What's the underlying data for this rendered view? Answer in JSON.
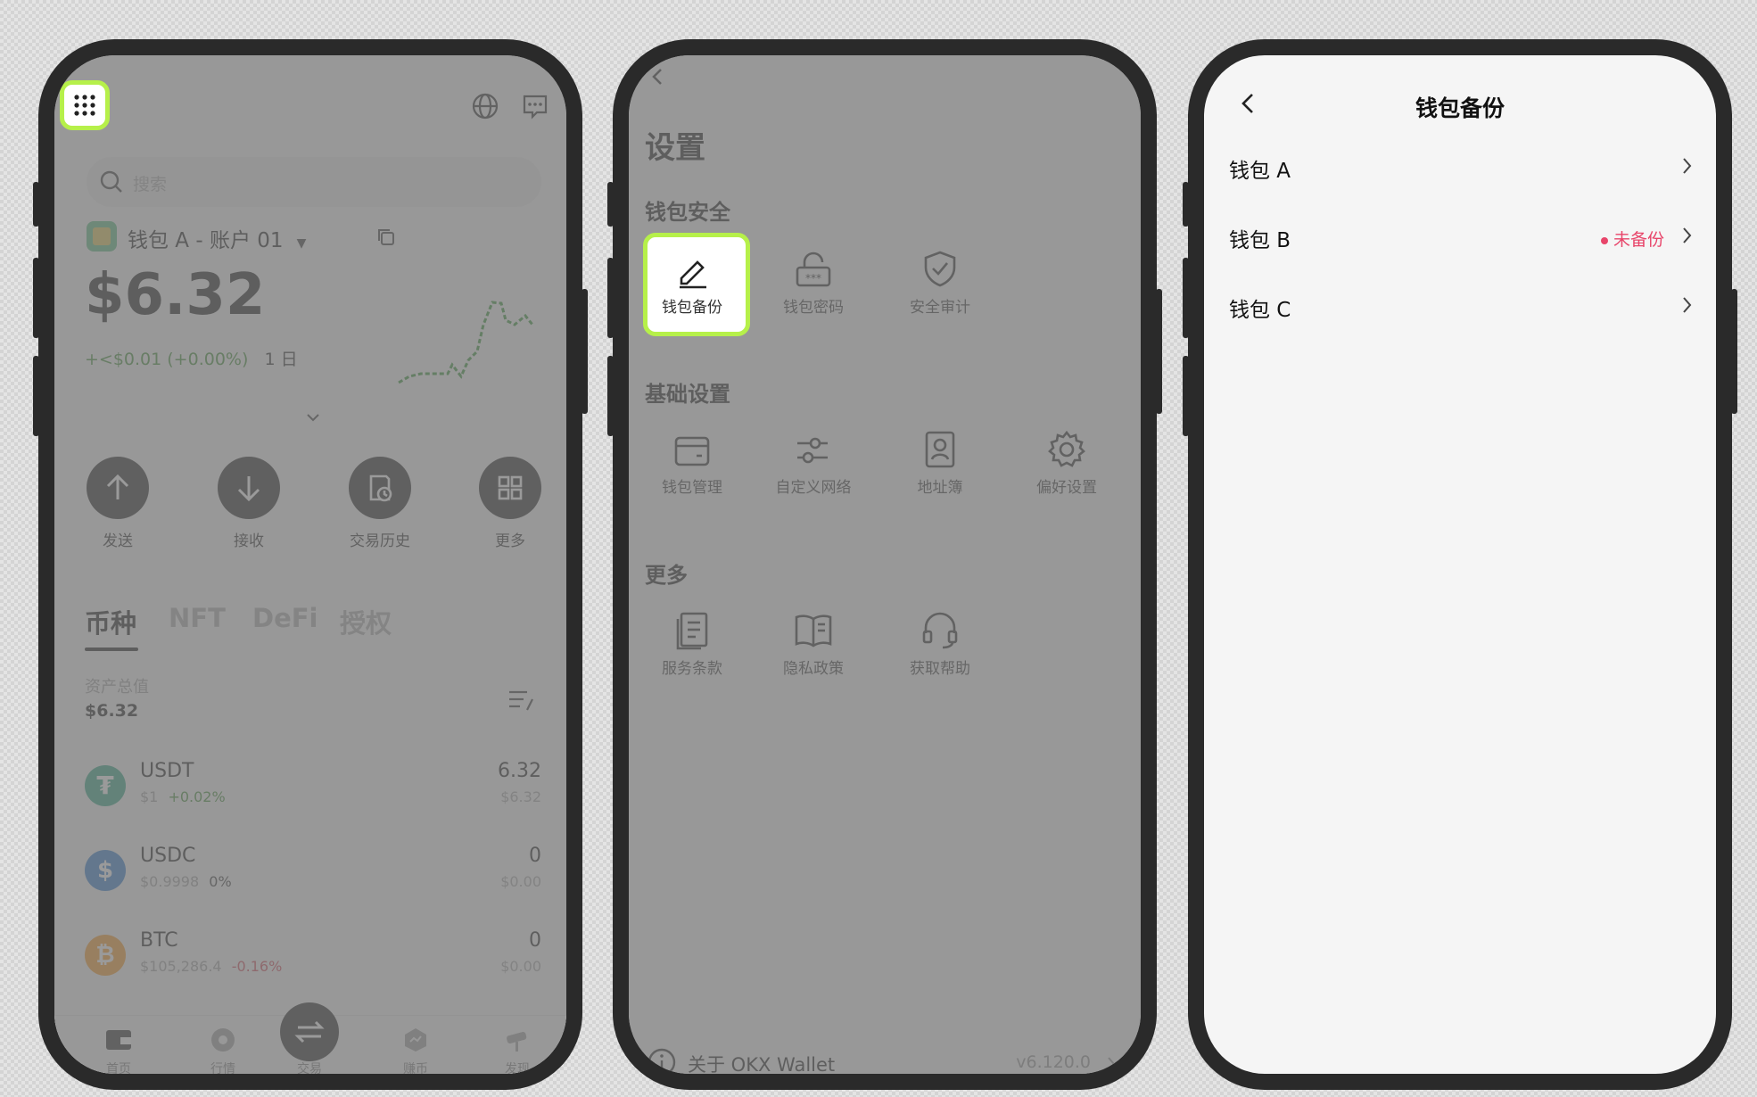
{
  "home": {
    "search_placeholder": "搜索",
    "account_name": "钱包 A - 账户 01",
    "balance": "$6.32",
    "change": "+<$0.01 (+0.00%)",
    "change_period": "1 日",
    "actions": [
      "发送",
      "接收",
      "交易历史",
      "更多"
    ],
    "tabs": [
      "币种",
      "NFT",
      "DeFi",
      "授权"
    ],
    "total_label": "资产总值",
    "total_value": "$6.32",
    "coins": [
      {
        "symbol": "USDT",
        "price": "$1",
        "change": "+0.02%",
        "amount": "6.32",
        "usd": "$6.32",
        "color": "#26a17b"
      },
      {
        "symbol": "USDC",
        "price": "$0.9998",
        "change": "0%",
        "amount": "0",
        "usd": "$0.00",
        "color": "#2775ca"
      },
      {
        "symbol": "BTC",
        "price": "$105,286.4",
        "change": "-0.16%",
        "amount": "0",
        "usd": "$0.00",
        "color": "#f7931a"
      }
    ],
    "nav": [
      "首页",
      "行情",
      "交易",
      "赚币",
      "发现"
    ],
    "colors": {
      "positive": "#3a8a2e",
      "negative": "#d04050",
      "highlight": "#b6f04a"
    }
  },
  "settings": {
    "title": "设置",
    "sections": [
      {
        "title": "钱包安全",
        "items": [
          "钱包备份",
          "钱包密码",
          "安全审计"
        ]
      },
      {
        "title": "基础设置",
        "items": [
          "钱包管理",
          "自定义网络",
          "地址簿",
          "偏好设置"
        ]
      },
      {
        "title": "更多",
        "items": [
          "服务条款",
          "隐私政策",
          "获取帮助"
        ]
      }
    ],
    "about_label": "关于 OKX Wallet",
    "version": "v6.120.0"
  },
  "backup": {
    "title": "钱包备份",
    "wallets": [
      {
        "name": "钱包 A",
        "status": ""
      },
      {
        "name": "钱包 B",
        "status": "未备份"
      },
      {
        "name": "钱包 C",
        "status": ""
      }
    ],
    "status_color": "#e8456a"
  }
}
